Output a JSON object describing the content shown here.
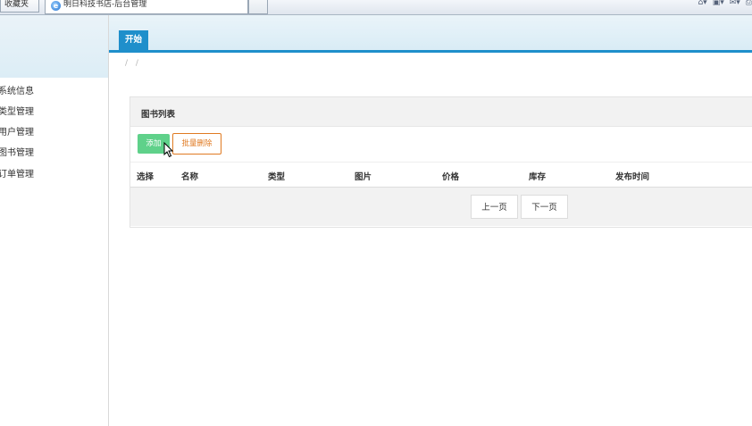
{
  "browser": {
    "favorites_label": "收藏夹",
    "tab_title": "明日科技书店-后台管理"
  },
  "sidebar": {
    "items": [
      {
        "label": "系统信息"
      },
      {
        "label": "类型管理"
      },
      {
        "label": "用户管理"
      },
      {
        "label": "图书管理"
      },
      {
        "label": "订单管理"
      }
    ]
  },
  "tabs": {
    "start_label": "开始"
  },
  "breadcrumb": {
    "text": "/ /"
  },
  "panel": {
    "title": "图书列表",
    "add_label": "添加",
    "batch_delete_label": "批量删除"
  },
  "table": {
    "headers": [
      "选择",
      "名称",
      "类型",
      "图片",
      "价格",
      "库存",
      "发布时间"
    ]
  },
  "pager": {
    "prev_label": "上一页",
    "next_label": "下一页"
  },
  "colors": {
    "accent": "#1f8fcb",
    "add_button": "#5fd18a",
    "batch_delete_border": "#e07a22"
  }
}
